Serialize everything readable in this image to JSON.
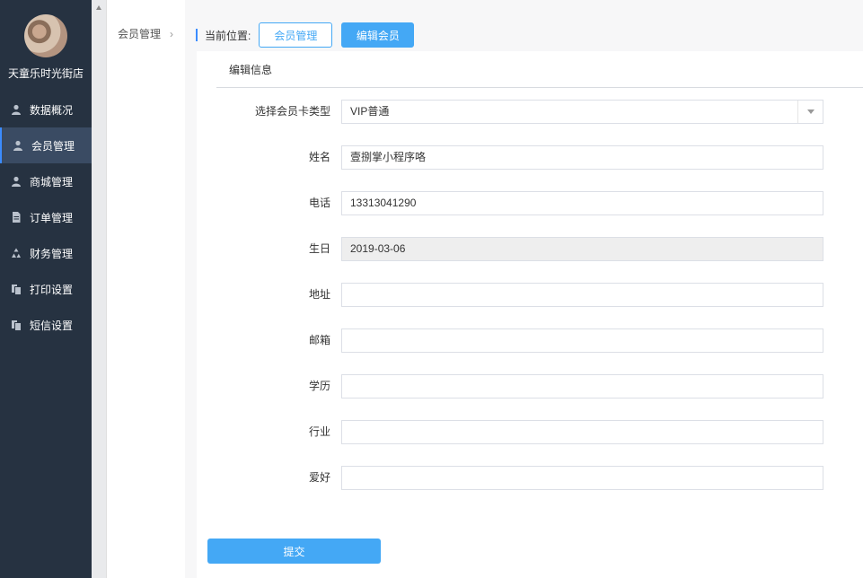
{
  "sidebar": {
    "store_name": "天童乐时光街店",
    "items": [
      {
        "label": "数据概况",
        "icon": "user-icon"
      },
      {
        "label": "会员管理",
        "icon": "user-icon",
        "active": true
      },
      {
        "label": "商城管理",
        "icon": "user-icon"
      },
      {
        "label": "订单管理",
        "icon": "document-icon"
      },
      {
        "label": "财务管理",
        "icon": "recycle-icon"
      },
      {
        "label": "打印设置",
        "icon": "copy-icon"
      },
      {
        "label": "短信设置",
        "icon": "copy-icon"
      }
    ]
  },
  "subnav": {
    "item": "会员管理",
    "chevron": "›"
  },
  "breadcrumb": {
    "label": "当前位置:",
    "crumb1": "会员管理",
    "crumb2": "编辑会员"
  },
  "form": {
    "section_title": "编辑信息",
    "card_type": {
      "label": "选择会员卡类型",
      "value": "VIP普通"
    },
    "name": {
      "label": "姓名",
      "value": "壹捌掌小程序咯"
    },
    "phone": {
      "label": "电话",
      "value": "13313041290"
    },
    "birthday": {
      "label": "生日",
      "value": "2019-03-06"
    },
    "address": {
      "label": "地址",
      "value": ""
    },
    "email": {
      "label": "邮箱",
      "value": ""
    },
    "education": {
      "label": "学历",
      "value": ""
    },
    "industry": {
      "label": "行业",
      "value": ""
    },
    "hobby": {
      "label": "爱好",
      "value": ""
    },
    "submit_label": "提交"
  },
  "colors": {
    "sidebar_bg": "#263241",
    "accent": "#44a8f5"
  }
}
